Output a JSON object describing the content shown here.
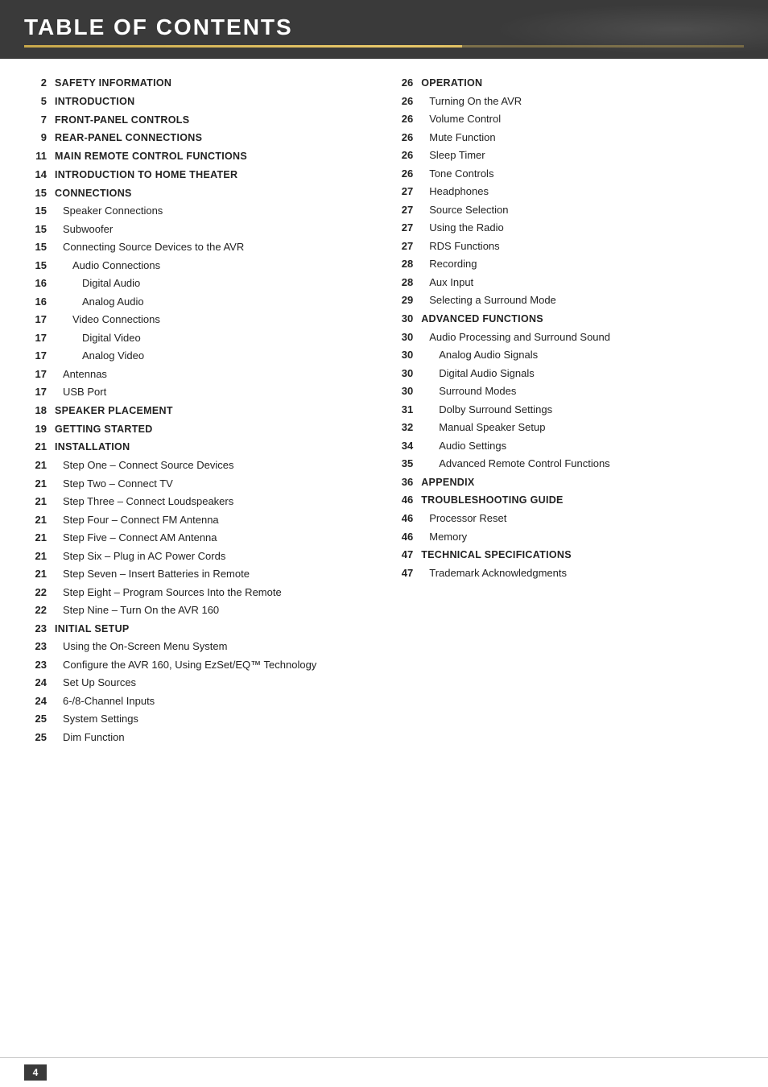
{
  "header": {
    "title": "TABLE OF CONTENTS"
  },
  "footer": {
    "page": "4"
  },
  "left_column": [
    {
      "page": "2",
      "title": "SAFETY INFORMATION",
      "level": "top"
    },
    {
      "page": "5",
      "title": "INTRODUCTION",
      "level": "top"
    },
    {
      "page": "7",
      "title": "FRONT-PANEL CONTROLS",
      "level": "top"
    },
    {
      "page": "9",
      "title": "REAR-PANEL CONNECTIONS",
      "level": "top"
    },
    {
      "page": "11",
      "title": "MAIN REMOTE CONTROL FUNCTIONS",
      "level": "top"
    },
    {
      "page": "14",
      "title": "INTRODUCTION TO HOME THEATER",
      "level": "top"
    },
    {
      "page": "15",
      "title": "CONNECTIONS",
      "level": "top"
    },
    {
      "page": "15",
      "title": "Speaker Connections",
      "level": "sub1"
    },
    {
      "page": "15",
      "title": "Subwoofer",
      "level": "sub1"
    },
    {
      "page": "15",
      "title": "Connecting Source Devices to the AVR",
      "level": "sub1"
    },
    {
      "page": "15",
      "title": "Audio Connections",
      "level": "sub2"
    },
    {
      "page": "16",
      "title": "Digital Audio",
      "level": "sub3"
    },
    {
      "page": "16",
      "title": "Analog Audio",
      "level": "sub3"
    },
    {
      "page": "17",
      "title": "Video Connections",
      "level": "sub2"
    },
    {
      "page": "17",
      "title": "Digital Video",
      "level": "sub3"
    },
    {
      "page": "17",
      "title": "Analog Video",
      "level": "sub3"
    },
    {
      "page": "17",
      "title": "Antennas",
      "level": "sub1"
    },
    {
      "page": "17",
      "title": "USB Port",
      "level": "sub1"
    },
    {
      "page": "18",
      "title": "SPEAKER PLACEMENT",
      "level": "top"
    },
    {
      "page": "19",
      "title": "GETTING STARTED",
      "level": "top"
    },
    {
      "page": "21",
      "title": "INSTALLATION",
      "level": "top"
    },
    {
      "page": "21",
      "title": "Step One – Connect Source Devices",
      "level": "sub1"
    },
    {
      "page": "21",
      "title": "Step Two – Connect TV",
      "level": "sub1"
    },
    {
      "page": "21",
      "title": "Step Three – Connect Loudspeakers",
      "level": "sub1"
    },
    {
      "page": "21",
      "title": "Step Four – Connect FM Antenna",
      "level": "sub1"
    },
    {
      "page": "21",
      "title": "Step Five – Connect AM Antenna",
      "level": "sub1"
    },
    {
      "page": "21",
      "title": "Step Six – Plug in AC Power Cords",
      "level": "sub1"
    },
    {
      "page": "21",
      "title": "Step Seven – Insert Batteries in Remote",
      "level": "sub1"
    },
    {
      "page": "22",
      "title": "Step Eight – Program Sources Into the Remote",
      "level": "sub1"
    },
    {
      "page": "22",
      "title": "Step Nine – Turn On the AVR 160",
      "level": "sub1"
    },
    {
      "page": "23",
      "title": "INITIAL SETUP",
      "level": "top"
    },
    {
      "page": "23",
      "title": "Using the On-Screen Menu System",
      "level": "sub1"
    },
    {
      "page": "23",
      "title": "Configure the AVR 160, Using EzSet/EQ™ Technology",
      "level": "sub1"
    },
    {
      "page": "24",
      "title": "Set Up Sources",
      "level": "sub1"
    },
    {
      "page": "24",
      "title": "6-/8-Channel Inputs",
      "level": "sub1"
    },
    {
      "page": "25",
      "title": "System Settings",
      "level": "sub1"
    },
    {
      "page": "25",
      "title": "Dim Function",
      "level": "sub1"
    }
  ],
  "right_column": [
    {
      "page": "26",
      "title": "OPERATION",
      "level": "top"
    },
    {
      "page": "26",
      "title": "Turning On the AVR",
      "level": "sub1"
    },
    {
      "page": "26",
      "title": "Volume Control",
      "level": "sub1"
    },
    {
      "page": "26",
      "title": "Mute Function",
      "level": "sub1"
    },
    {
      "page": "26",
      "title": "Sleep Timer",
      "level": "sub1"
    },
    {
      "page": "26",
      "title": "Tone Controls",
      "level": "sub1"
    },
    {
      "page": "27",
      "title": "Headphones",
      "level": "sub1"
    },
    {
      "page": "27",
      "title": "Source Selection",
      "level": "sub1"
    },
    {
      "page": "27",
      "title": "Using the Radio",
      "level": "sub1"
    },
    {
      "page": "27",
      "title": "RDS Functions",
      "level": "sub1"
    },
    {
      "page": "28",
      "title": "Recording",
      "level": "sub1"
    },
    {
      "page": "28",
      "title": "Aux Input",
      "level": "sub1"
    },
    {
      "page": "29",
      "title": "Selecting a Surround Mode",
      "level": "sub1"
    },
    {
      "page": "30",
      "title": "ADVANCED FUNCTIONS",
      "level": "top"
    },
    {
      "page": "30",
      "title": "Audio Processing and Surround Sound",
      "level": "sub1"
    },
    {
      "page": "30",
      "title": "Analog Audio Signals",
      "level": "sub2"
    },
    {
      "page": "30",
      "title": "Digital Audio Signals",
      "level": "sub2"
    },
    {
      "page": "30",
      "title": "Surround Modes",
      "level": "sub2"
    },
    {
      "page": "31",
      "title": "Dolby Surround Settings",
      "level": "sub2"
    },
    {
      "page": "32",
      "title": "Manual Speaker Setup",
      "level": "sub2"
    },
    {
      "page": "34",
      "title": "Audio Settings",
      "level": "sub2"
    },
    {
      "page": "35",
      "title": "Advanced Remote Control Functions",
      "level": "sub2"
    },
    {
      "page": "36",
      "title": "APPENDIX",
      "level": "top"
    },
    {
      "page": "46",
      "title": "TROUBLESHOOTING GUIDE",
      "level": "top"
    },
    {
      "page": "46",
      "title": "Processor Reset",
      "level": "sub1"
    },
    {
      "page": "46",
      "title": "Memory",
      "level": "sub1"
    },
    {
      "page": "47",
      "title": "TECHNICAL SPECIFICATIONS",
      "level": "top"
    },
    {
      "page": "47",
      "title": "Trademark Acknowledgments",
      "level": "sub1"
    }
  ]
}
